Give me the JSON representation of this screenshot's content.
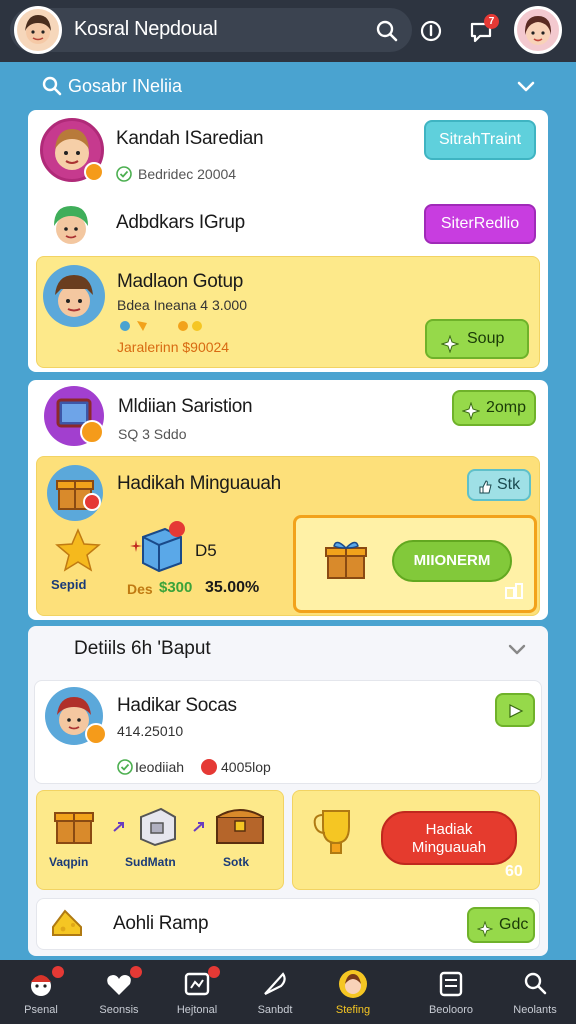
{
  "header": {
    "title": "Kosral Nepdoual",
    "bell_badge": "7",
    "section_label": "Gosabr INeliia"
  },
  "panel1": {
    "row1": {
      "title": "Kandah ISaredian",
      "sub": "Bedridec 20004",
      "button": "SitrahTraint"
    },
    "row2": {
      "title": "Adbdkars IGrup",
      "button": "SiterRedlio"
    },
    "row3": {
      "title": "Madlaon Gotup",
      "sub1": "Bdea Ineana 4 3.000",
      "sub2": "Jaralerinn $90024",
      "button": "Soup"
    }
  },
  "panel2": {
    "row1": {
      "title": "Mldiian Saristion",
      "sub": "SQ 3 Sddo",
      "button": "2omp"
    },
    "row2": {
      "title": "Hadikah Minguauah",
      "button": "Stk"
    },
    "rewards": {
      "star_label": "Sepid",
      "gem_value": "D5",
      "price_old": "Des",
      "price_green": "$300",
      "price_main": "35.00%",
      "claim_button": "MIIONERM"
    }
  },
  "section2": {
    "title": "Detiils 6h 'Baput"
  },
  "panel3": {
    "row1": {
      "title": "Hadikar Socas",
      "sub": "414.25010",
      "sub2": "Ieodiiah",
      "sub3": "4005lop"
    },
    "items": [
      "Vaqpin",
      "SudMatn",
      "Sotk"
    ],
    "mingu_button_line1": "Hadiak",
    "mingu_button_line2": "Minguauah",
    "corner_value": "60",
    "last_row": {
      "title": "Aohli Ramp",
      "button": "Gdc"
    }
  },
  "nav": {
    "items": [
      {
        "label": "Psenal"
      },
      {
        "label": "Seonsis"
      },
      {
        "label": "Hejtonal"
      },
      {
        "label": "Sanbdt"
      },
      {
        "label": "Stefing"
      },
      {
        "label": "Beolooro"
      },
      {
        "label": "Neolants"
      }
    ]
  },
  "colors": {
    "accent_teal": "#5fd0dc",
    "accent_purple": "#c83de0",
    "accent_green": "#96d94a",
    "accent_red": "#e53b2e",
    "card_yellow": "#fde98a"
  }
}
